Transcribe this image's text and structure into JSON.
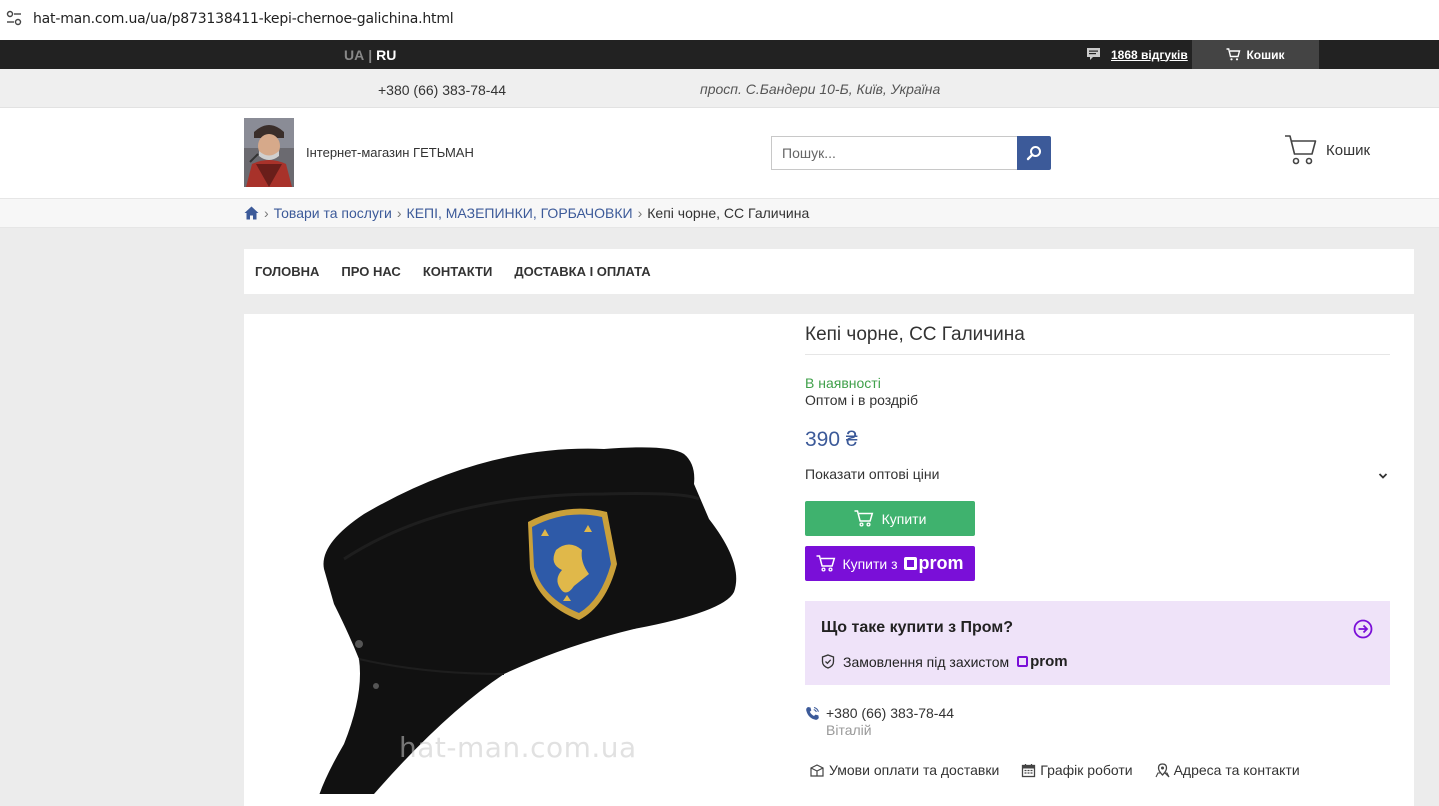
{
  "browser": {
    "url": "hat-man.com.ua/ua/p873138411-kepi-chernoe-galichina.html"
  },
  "topbar": {
    "lang_ua": "UA",
    "lang_sep": "|",
    "lang_ru": "RU",
    "reviews": "1868 відгуків",
    "cart": "Кошик"
  },
  "infobar": {
    "phone": "+380 (66) 383-78-44",
    "address": "просп. С.Бандери 10-Б, Київ, Україна"
  },
  "header": {
    "shop_name": "Інтернет-магазин ГЕТЬМАН",
    "search_placeholder": "Пошук...",
    "cart": "Кошик"
  },
  "breadcrumb": {
    "items": [
      "Товари та послуги",
      "КЕПІ, МАЗЕПИНКИ, ГОРБАЧОВКИ"
    ],
    "current": "Кепі чорне, СС Галичина",
    "separator": "›"
  },
  "nav": {
    "items": [
      "ГОЛОВНА",
      "ПРО НАС",
      "КОНТАКТИ",
      "ДОСТАВКА І ОПЛАТА"
    ]
  },
  "product": {
    "title": "Кепі чорне, СС Галичина",
    "availability": "В наявності",
    "sale_type": "Оптом і в роздріб",
    "price": "390 ₴",
    "show_wholesale": "Показати оптові ціни",
    "buy_label": "Купити",
    "buy_prom_label": "Купити з",
    "prom_brand": "prom",
    "watermark": "hat-man.com.ua",
    "prom_box": {
      "title": "Що таке купити з Пром?",
      "protection": "Замовлення під захистом",
      "brand": "prom"
    },
    "contact": {
      "phone": "+380 (66) 383-78-44",
      "name": "Віталій"
    },
    "links": [
      "Умови оплати та доставки",
      "Графік роботи",
      "Адреса та контакти"
    ]
  },
  "colors": {
    "accent_blue": "#3c5a99",
    "buy_green": "#3fb26e",
    "prom_purple": "#7a0fd8",
    "in_stock_green": "#3fa04a"
  }
}
